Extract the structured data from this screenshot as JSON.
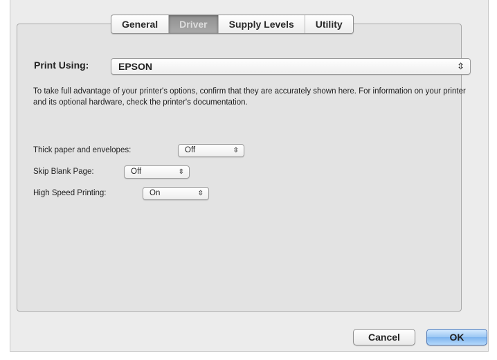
{
  "tabs": [
    {
      "label": "General",
      "selected": false
    },
    {
      "label": "Driver",
      "selected": true
    },
    {
      "label": "Supply Levels",
      "selected": false
    },
    {
      "label": "Utility",
      "selected": false
    }
  ],
  "print_using": {
    "label": "Print Using:",
    "value": "EPSON"
  },
  "description": "To take full advantage of your printer's options, confirm that they are accurately shown here. For information on your printer and its optional hardware, check the printer's documentation.",
  "options": [
    {
      "label": "Thick paper and envelopes:",
      "value": "Off"
    },
    {
      "label": "Skip Blank Page:",
      "value": "Off"
    },
    {
      "label": "High Speed Printing:",
      "value": "On"
    }
  ],
  "popup_arrows": "⇳",
  "buttons": {
    "cancel": "Cancel",
    "ok": "OK"
  },
  "colors": {
    "window_bg": "#ececec",
    "group_bg": "#e3e3e3",
    "selected_tab": "#9a9a9a",
    "default_button": "#8fc1f3"
  }
}
